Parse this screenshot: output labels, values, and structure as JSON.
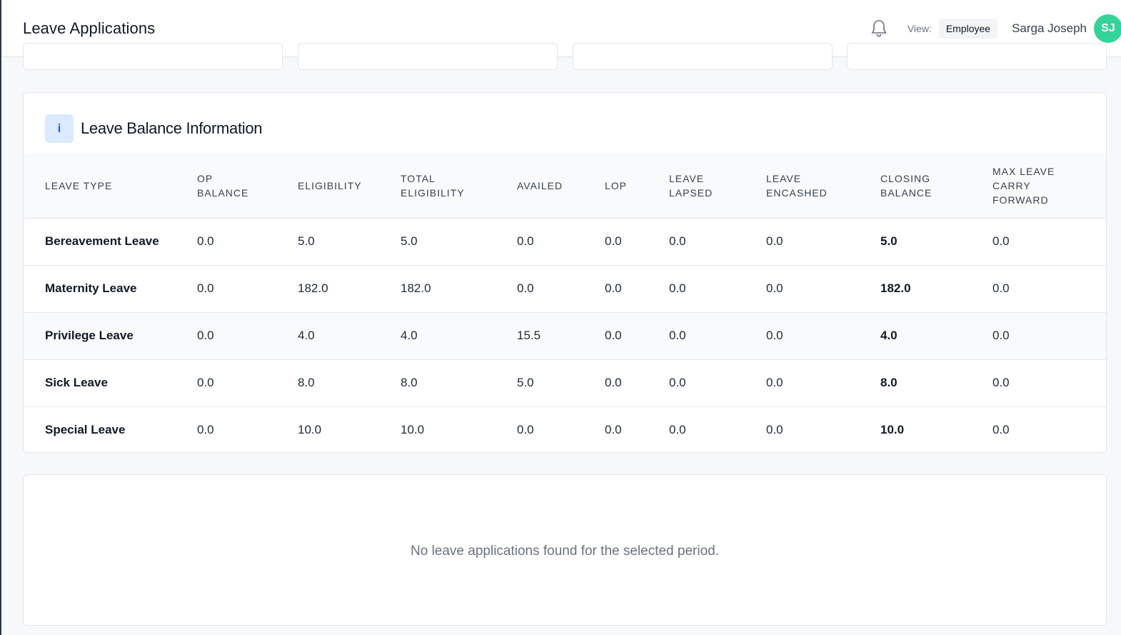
{
  "header": {
    "title": "Leave Applications",
    "view_label": "View:",
    "view_value": "Employee",
    "user_name": "Sarga Joseph",
    "avatar_initials": "SJ",
    "avatar_color": "#34d399",
    "bell_icon": "bell-icon"
  },
  "balance": {
    "info_icon": "i",
    "title": "Leave Balance Information",
    "columns": [
      [
        "LEAVE TYPE"
      ],
      [
        "OP",
        "BALANCE"
      ],
      [
        "ELIGIBILITY"
      ],
      [
        "TOTAL",
        "ELIGIBILITY"
      ],
      [
        "AVAILED"
      ],
      [
        "LOP"
      ],
      [
        "LEAVE",
        "LAPSED"
      ],
      [
        "LEAVE",
        "ENCASHED"
      ],
      [
        "CLOSING",
        "BALANCE"
      ],
      [
        "MAX LEAVE",
        "CARRY",
        "FORWARD"
      ]
    ],
    "rows": [
      [
        "Bereavement Leave",
        "0.0",
        "5.0",
        "5.0",
        "0.0",
        "0.0",
        "0.0",
        "0.0",
        "5.0",
        "0.0"
      ],
      [
        "Maternity Leave",
        "0.0",
        "182.0",
        "182.0",
        "0.0",
        "0.0",
        "0.0",
        "0.0",
        "182.0",
        "0.0"
      ],
      [
        "Privilege Leave",
        "0.0",
        "4.0",
        "4.0",
        "15.5",
        "0.0",
        "0.0",
        "0.0",
        "4.0",
        "0.0"
      ],
      [
        "Sick Leave",
        "0.0",
        "8.0",
        "8.0",
        "5.0",
        "0.0",
        "0.0",
        "0.0",
        "8.0",
        "0.0"
      ],
      [
        "Special Leave",
        "0.0",
        "10.0",
        "10.0",
        "0.0",
        "0.0",
        "0.0",
        "0.0",
        "10.0",
        "0.0"
      ]
    ]
  },
  "applications": {
    "empty_message": "No leave applications found for the selected period."
  }
}
